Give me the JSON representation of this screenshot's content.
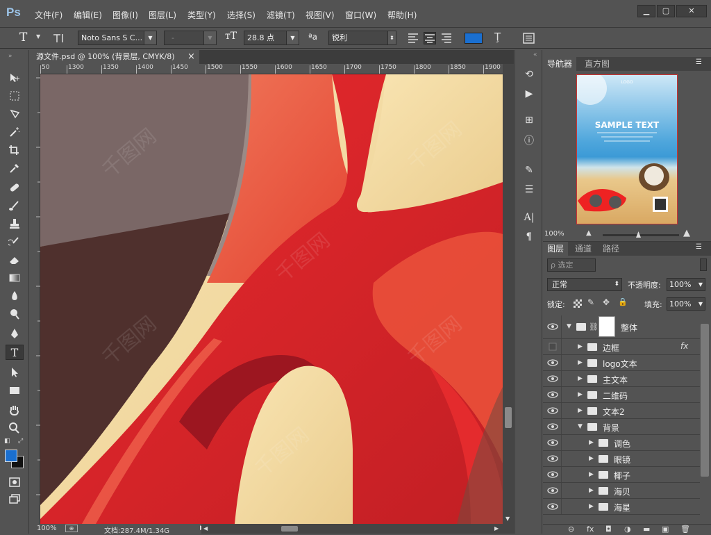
{
  "app": {
    "logo": "Ps"
  },
  "menu": [
    "文件(F)",
    "编辑(E)",
    "图像(I)",
    "图层(L)",
    "类型(Y)",
    "选择(S)",
    "滤镜(T)",
    "视图(V)",
    "窗口(W)",
    "帮助(H)"
  ],
  "window_buttons": [
    "▁",
    "▢",
    "✕"
  ],
  "options": {
    "tool_glyph": "T",
    "font_family": "Noto Sans S C...",
    "font_style": "-",
    "font_size": "28.8 点",
    "aa_label": "ªa",
    "antialias": "锐利",
    "color": "#1a6fd0"
  },
  "document": {
    "tab_title": "源文件.psd @ 100% (背景层, CMYK/8)",
    "close": "×"
  },
  "ruler": {
    "ticks": [
      "50",
      "1300",
      "1350",
      "1400",
      "1450",
      "1500",
      "1550",
      "1600",
      "1650",
      "1700",
      "1750",
      "1800",
      "1850",
      "1900"
    ]
  },
  "status": {
    "zoom": "100%",
    "doc": "文档:287.4M/1.34G"
  },
  "navigator": {
    "tabs": [
      "导航器",
      "直方图"
    ],
    "zoom": "100%",
    "thumb_logo": "LOGO",
    "thumb_title": "SAMPLE TEXT"
  },
  "layers_panel": {
    "tabs": [
      "图层",
      "通道",
      "路径"
    ],
    "filter": "ρ 选定",
    "blend_mode": "正常",
    "opacity_label": "不透明度:",
    "opacity": "100%",
    "lock_label": "锁定:",
    "fill_label": "填充:",
    "fill": "100%",
    "layers": [
      {
        "name": "整体",
        "level": 0,
        "expanded": true,
        "visible": true,
        "mask": true
      },
      {
        "name": "边框",
        "level": 1,
        "expanded": false,
        "visible": false,
        "fx": "fx"
      },
      {
        "name": "logo文本",
        "level": 1,
        "expanded": false,
        "visible": true
      },
      {
        "name": "主文本",
        "level": 1,
        "expanded": false,
        "visible": true
      },
      {
        "name": "二维码",
        "level": 1,
        "expanded": false,
        "visible": true
      },
      {
        "name": "文本2",
        "level": 1,
        "expanded": false,
        "visible": true
      },
      {
        "name": "背景",
        "level": 1,
        "expanded": true,
        "visible": true
      },
      {
        "name": "调色",
        "level": 2,
        "expanded": false,
        "visible": true
      },
      {
        "name": "眼镜",
        "level": 2,
        "expanded": false,
        "visible": true
      },
      {
        "name": "椰子",
        "level": 2,
        "expanded": false,
        "visible": true
      },
      {
        "name": "海贝",
        "level": 2,
        "expanded": false,
        "visible": true
      },
      {
        "name": "海星",
        "level": 2,
        "expanded": false,
        "visible": true
      }
    ],
    "footer": [
      "⊖",
      "fx",
      "◘",
      "◑",
      "▬",
      "▣",
      "🗑"
    ]
  },
  "colors": {
    "foreground": "#1a6fd0",
    "background": "#111111"
  }
}
